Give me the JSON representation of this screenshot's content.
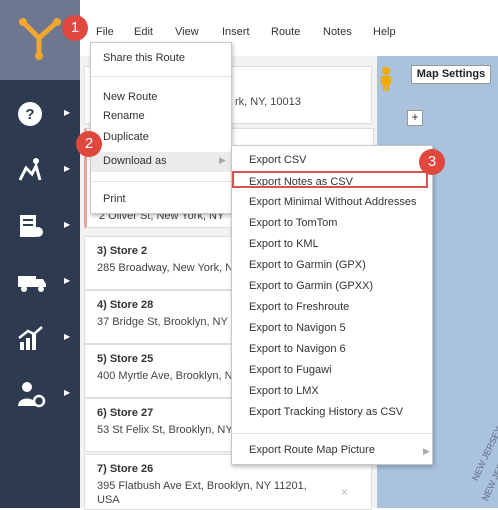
{
  "menubar": {
    "items": [
      "File",
      "Edit",
      "View",
      "Insert",
      "Route",
      "Notes",
      "Help"
    ]
  },
  "file_menu": {
    "share": "Share this Route",
    "new_route": "New Route",
    "rename": "Rename",
    "duplicate": "Duplicate",
    "download_as": "Download as",
    "print": "Print"
  },
  "export_menu": {
    "items": [
      "Export CSV",
      "Export Notes as CSV",
      "Export Minimal Without Addresses",
      "Export to TomTom",
      "Export to KML",
      "Export to Garmin (GPX)",
      "Export to Garmin (GPXX)",
      "Export to Freshroute",
      "Export to Navigon 5",
      "Export to Navigon 6",
      "Export to Fugawi",
      "Export to LMX",
      "Export Tracking History as CSV"
    ],
    "map_picture": "Export Route Map Picture",
    "highlighted": "Export Notes as CSV"
  },
  "route_list": {
    "stop1_partial": "rk, NY, 10013",
    "stop2_partial": "2 Oliver St, New York, NY",
    "stops": [
      {
        "title": "3) Store 2",
        "address": "285 Broadway, New York, N"
      },
      {
        "title": "4) Store 28",
        "address": "37 Bridge St, Brooklyn, NY"
      },
      {
        "title": "5) Store 25",
        "address": "400 Myrtle Ave, Brooklyn, N"
      },
      {
        "title": "6) Store 27",
        "address": "53 St Felix St, Brooklyn, NY"
      },
      {
        "title": "7) Store 26",
        "address": "395 Flatbush Ave Ext, Brooklyn, NY 11201, USA"
      }
    ],
    "remove_symbol": "×"
  },
  "map": {
    "settings_button": "Map Settings",
    "zoom_in": "+",
    "labels": [
      "NEW JERSEY",
      "NEW JERSEY"
    ]
  },
  "steps": [
    "1",
    "2",
    "3"
  ],
  "colors": {
    "sidebar": "#2d3a4f",
    "accent": "#e0473d",
    "logo": "#f0a630"
  }
}
